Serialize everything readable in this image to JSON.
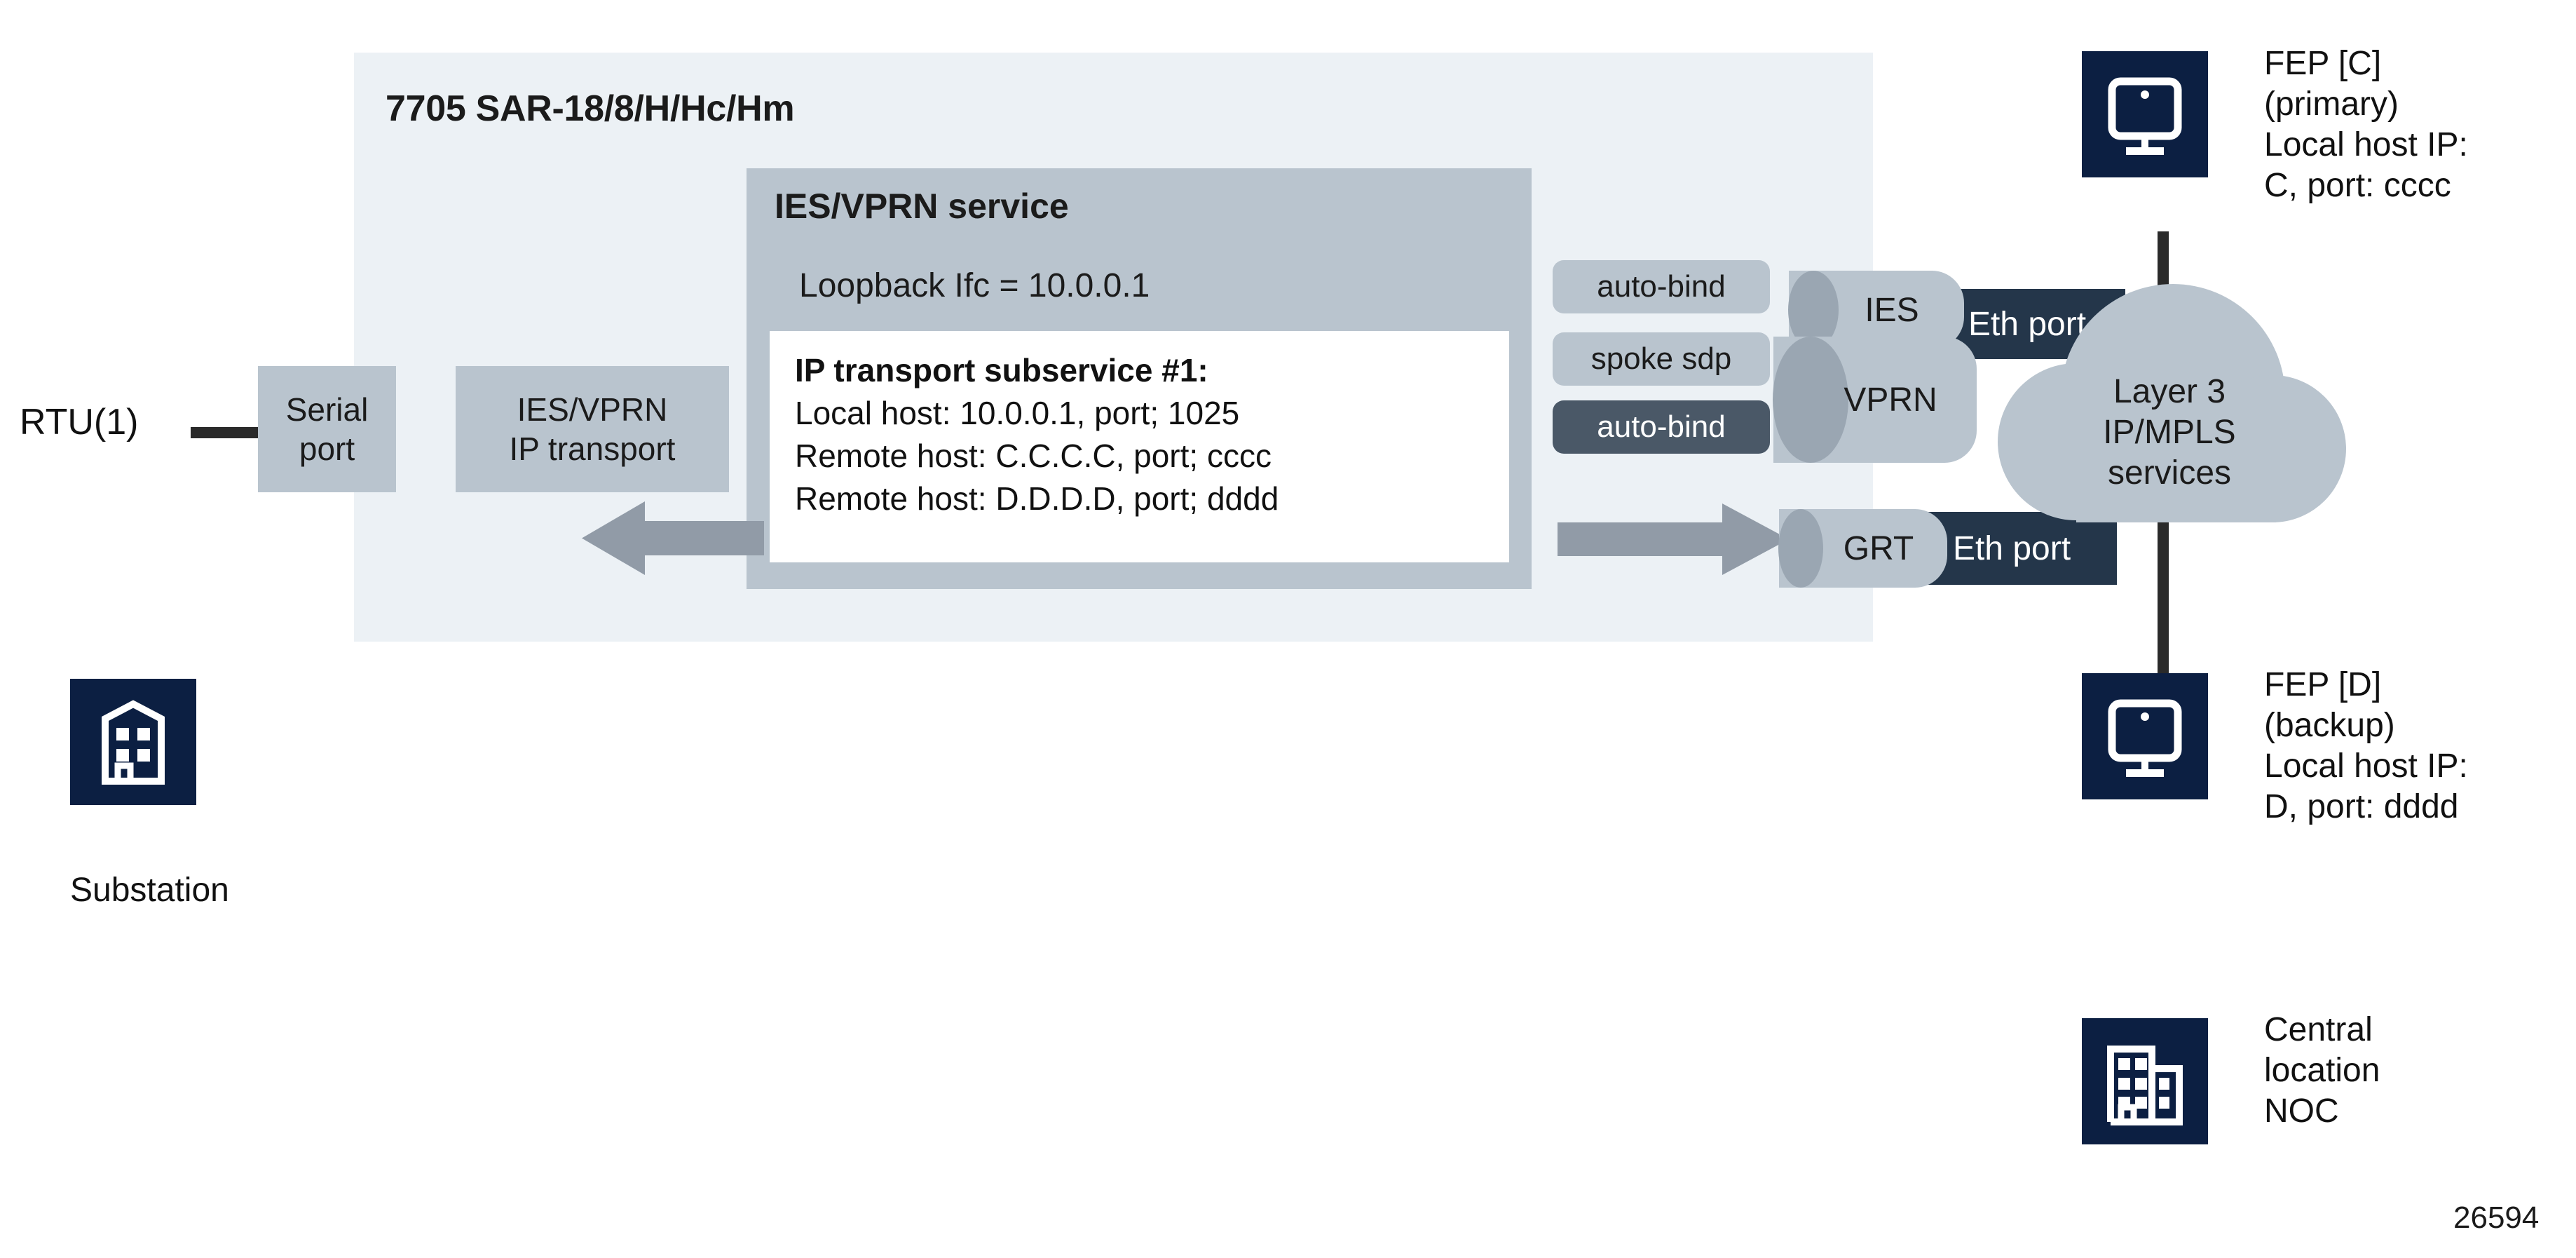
{
  "figure": {
    "number": "26594"
  },
  "sar": {
    "title": "7705 SAR-18/8/H/Hc/Hm"
  },
  "left": {
    "rtu_label": "RTU(1)",
    "serial_port_label": "Serial\nport",
    "ip_transport_label": "IES/VPRN\nIP transport",
    "substation_label": "Substation",
    "substation_icon": "building-icon"
  },
  "service": {
    "title": "IES/VPRN service",
    "loopback": "Loopback Ifc = 10.0.0.1",
    "subservice": {
      "heading": "IP transport subservice #1:",
      "local_host": "Local host: 10.0.0.1, port; 1025",
      "remote_host_1": "Remote host: C.C.C.C, port; cccc",
      "remote_host_2": "Remote host: D.D.D.D, port; dddd"
    }
  },
  "bindings": {
    "auto_bind_top": "auto-bind",
    "spoke_sdp": "spoke sdp",
    "auto_bind_bottom": "auto-bind"
  },
  "instances": {
    "ies": "IES",
    "vprn": "VPRN",
    "grt": "GRT"
  },
  "ports": {
    "eth_top": "Eth port",
    "eth_bottom": "Eth port"
  },
  "cloud": {
    "label": "Layer 3\nIP/MPLS\nservices"
  },
  "right": {
    "fep_c": {
      "text": "FEP [C]\n(primary)\nLocal host IP:\nC, port: cccc",
      "icon": "monitor-icon"
    },
    "fep_d": {
      "text": "FEP [D]\n(backup)\nLocal host IP:\nD, port: dddd",
      "icon": "monitor-icon"
    },
    "noc": {
      "text": "Central\nlocation\nNOC",
      "icon": "office-building-icon"
    }
  },
  "colors": {
    "panel_bg": "#ecf1f5",
    "service_bg": "#b9c4ce",
    "subservice_bg": "#ffffff",
    "navy": "#0c1f42",
    "eth_port": "#24364a",
    "arrow": "#919ba7",
    "pill_dark": "#4a5867",
    "cylinder_cap": "#9aa6b2",
    "line": "#2a2a2a"
  }
}
